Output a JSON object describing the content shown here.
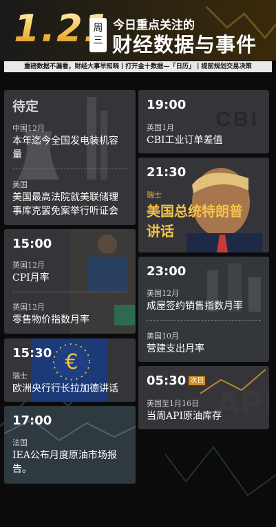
{
  "header": {
    "date": "1.21",
    "weekday_top": "周",
    "weekday_bottom": "三",
    "small_title": "今日重点关注的",
    "big_title": "财经数据与事件",
    "subtitle": "重磅数据不漏看，财经大事早知晓丨打开金十数据—「日历」丨提前规划交易决策"
  },
  "left_column": [
    {
      "time": "待定",
      "items": [
        {
          "region": "中国12月",
          "title_lines": [
            "本年迄今全国发电装机容",
            "量"
          ]
        },
        {
          "region": "美国",
          "title_lines": [
            "美国最高法院就美联储理",
            "事库克罢免案举行听证会"
          ]
        }
      ]
    },
    {
      "time": "15:00",
      "items": [
        {
          "region": "英国12月",
          "title_lines": [
            "CPI月率"
          ]
        },
        {
          "region": "英国12月",
          "title_lines": [
            "零售物价指数月率"
          ]
        }
      ]
    },
    {
      "time": "15:30",
      "items": [
        {
          "region": "瑞士",
          "title_lines": [
            "欧洲央行行长拉加德讲话"
          ]
        }
      ]
    },
    {
      "time": "17:00",
      "items": [
        {
          "region": "法国",
          "title_lines": [
            "IEA公布月度原油市场报",
            "告。"
          ]
        }
      ]
    }
  ],
  "right_column": [
    {
      "time": "19:00",
      "logo_text": "CBI",
      "items": [
        {
          "region": "英国1月",
          "title_lines": [
            "CBI工业订单差值"
          ]
        }
      ]
    },
    {
      "time": "21:30",
      "items": [
        {
          "region": "瑞士",
          "title_lines": [
            "美国总统特朗普",
            "讲话"
          ]
        }
      ]
    },
    {
      "time": "23:00",
      "items": [
        {
          "region": "美国12月",
          "title_lines": [
            "成屋签约销售指数月率"
          ]
        },
        {
          "region": "美国10月",
          "title_lines": [
            "营建支出月率"
          ]
        }
      ]
    },
    {
      "time": "05:30",
      "badge": "次日",
      "items": [
        {
          "region": "美国至1月16日",
          "title_lines": [
            "当周API原油库存"
          ]
        }
      ]
    }
  ],
  "colors": {
    "gold": "#f4c24b",
    "card_bg": "#3a3a3e",
    "badge": "#d78b1c"
  }
}
